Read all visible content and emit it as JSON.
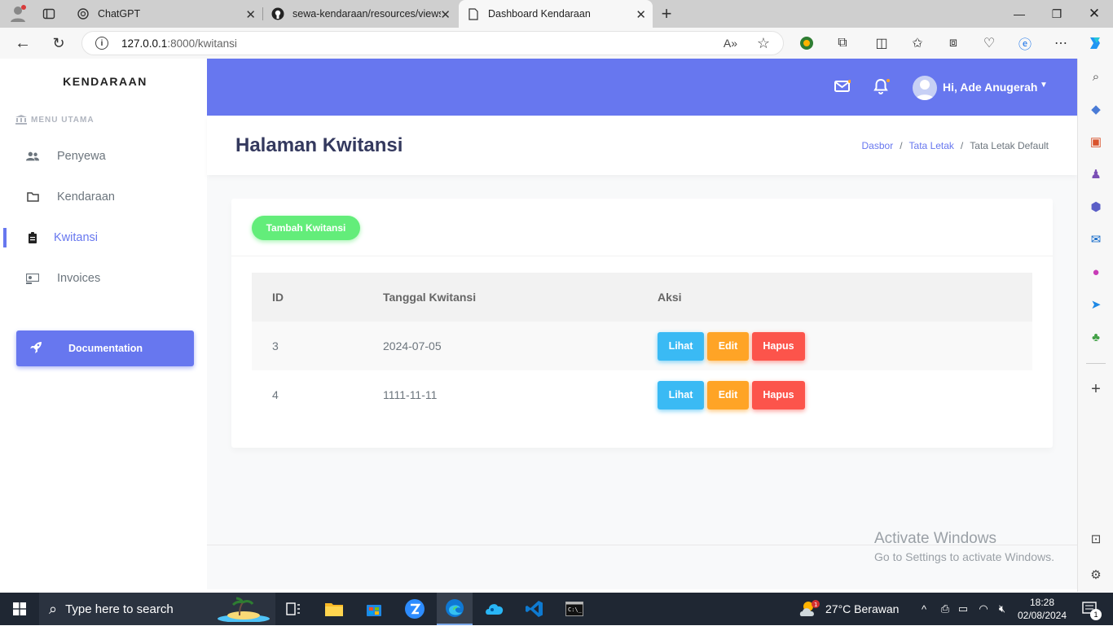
{
  "browser": {
    "tabs": [
      {
        "title": "ChatGPT",
        "icon": "chatgpt-icon"
      },
      {
        "title": "sewa-kendaraan/resources/views",
        "icon": "github-icon"
      },
      {
        "title": "Dashboard Kendaraan",
        "icon": "page-icon"
      }
    ],
    "url_host": "127.0.0.1",
    "url_path": ":8000/kwitansi"
  },
  "sidebar": {
    "brand": "KENDARAAN",
    "menu_header": "MENU UTAMA",
    "items": [
      {
        "label": "Penyewa",
        "icon": "users-icon"
      },
      {
        "label": "Kendaraan",
        "icon": "folder-icon"
      },
      {
        "label": "Kwitansi",
        "icon": "clipboard-icon",
        "active": true
      },
      {
        "label": "Invoices",
        "icon": "invoice-icon"
      }
    ],
    "doc_button": "Documentation"
  },
  "topnav": {
    "greeting": "Hi, Ade Anugerah"
  },
  "header": {
    "title": "Halaman Kwitansi",
    "breadcrumb": [
      "Dasbor",
      "Tata Letak",
      "Tata Letak Default"
    ]
  },
  "main": {
    "add_button": "Tambah Kwitansi",
    "columns": [
      "ID",
      "Tanggal Kwitansi",
      "Aksi"
    ],
    "rows": [
      {
        "id": "3",
        "date": "2024-07-05"
      },
      {
        "id": "4",
        "date": "1111-11-11"
      }
    ],
    "actions": {
      "view": "Lihat",
      "edit": "Edit",
      "delete": "Hapus"
    }
  },
  "watermark": {
    "line1": "Activate Windows",
    "line2": "Go to Settings to activate Windows."
  },
  "taskbar": {
    "search_placeholder": "Type here to search",
    "weather": "27°C  Berawan",
    "time": "18:28",
    "date": "02/08/2024",
    "notif_count": "1"
  },
  "colors": {
    "primary": "#6777ef",
    "success": "#63ed7a",
    "info": "#3abaf4",
    "warning": "#ffa426",
    "danger": "#fc544b"
  }
}
